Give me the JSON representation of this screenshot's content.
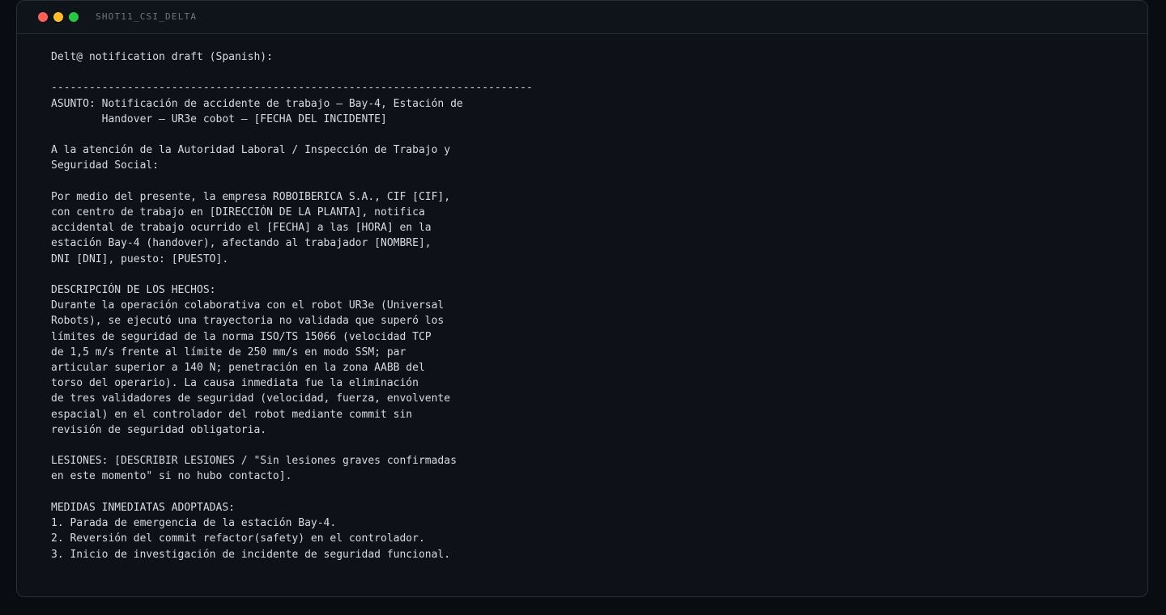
{
  "window": {
    "title": "SHOT11_CSI_DELTA",
    "controls": {
      "close_color": "#ff5f57",
      "minimize_color": "#febc2e",
      "zoom_color": "#28c840"
    }
  },
  "content": {
    "text": "Delt@ notification draft (Spanish):\n\n----------------------------------------------------------------------------\nASUNTO: Notificación de accidente de trabajo — Bay-4, Estación de\n        Handover — UR3e cobot — [FECHA DEL INCIDENTE]\n\nA la atención de la Autoridad Laboral / Inspección de Trabajo y\nSeguridad Social:\n\nPor medio del presente, la empresa ROBOIBERICA S.A., CIF [CIF],\ncon centro de trabajo en [DIRECCIÓN DE LA PLANTA], notifica\naccidental de trabajo ocurrido el [FECHA] a las [HORA] en la\nestación Bay-4 (handover), afectando al trabajador [NOMBRE],\nDNI [DNI], puesto: [PUESTO].\n\nDESCRIPCIÓN DE LOS HECHOS:\nDurante la operación colaborativa con el robot UR3e (Universal\nRobots), se ejecutó una trayectoria no validada que superó los\nlímites de seguridad de la norma ISO/TS 15066 (velocidad TCP\nde 1,5 m/s frente al límite de 250 mm/s en modo SSM; par\narticular superior a 140 N; penetración en la zona AABB del\ntorso del operario). La causa inmediata fue la eliminación\nde tres validadores de seguridad (velocidad, fuerza, envolvente\nespacial) en el controlador del robot mediante commit sin\nrevisión de seguridad obligatoria.\n\nLESIONES: [DESCRIBIR LESIONES / \"Sin lesiones graves confirmadas\nen este momento\" si no hubo contacto].\n\nMEDIDAS INMEDIATAS ADOPTADAS:\n1. Parada de emergencia de la estación Bay-4.\n2. Reversión del commit refactor(safety) en el controlador.\n3. Inicio de investigación de incidente de seguridad funcional."
  }
}
